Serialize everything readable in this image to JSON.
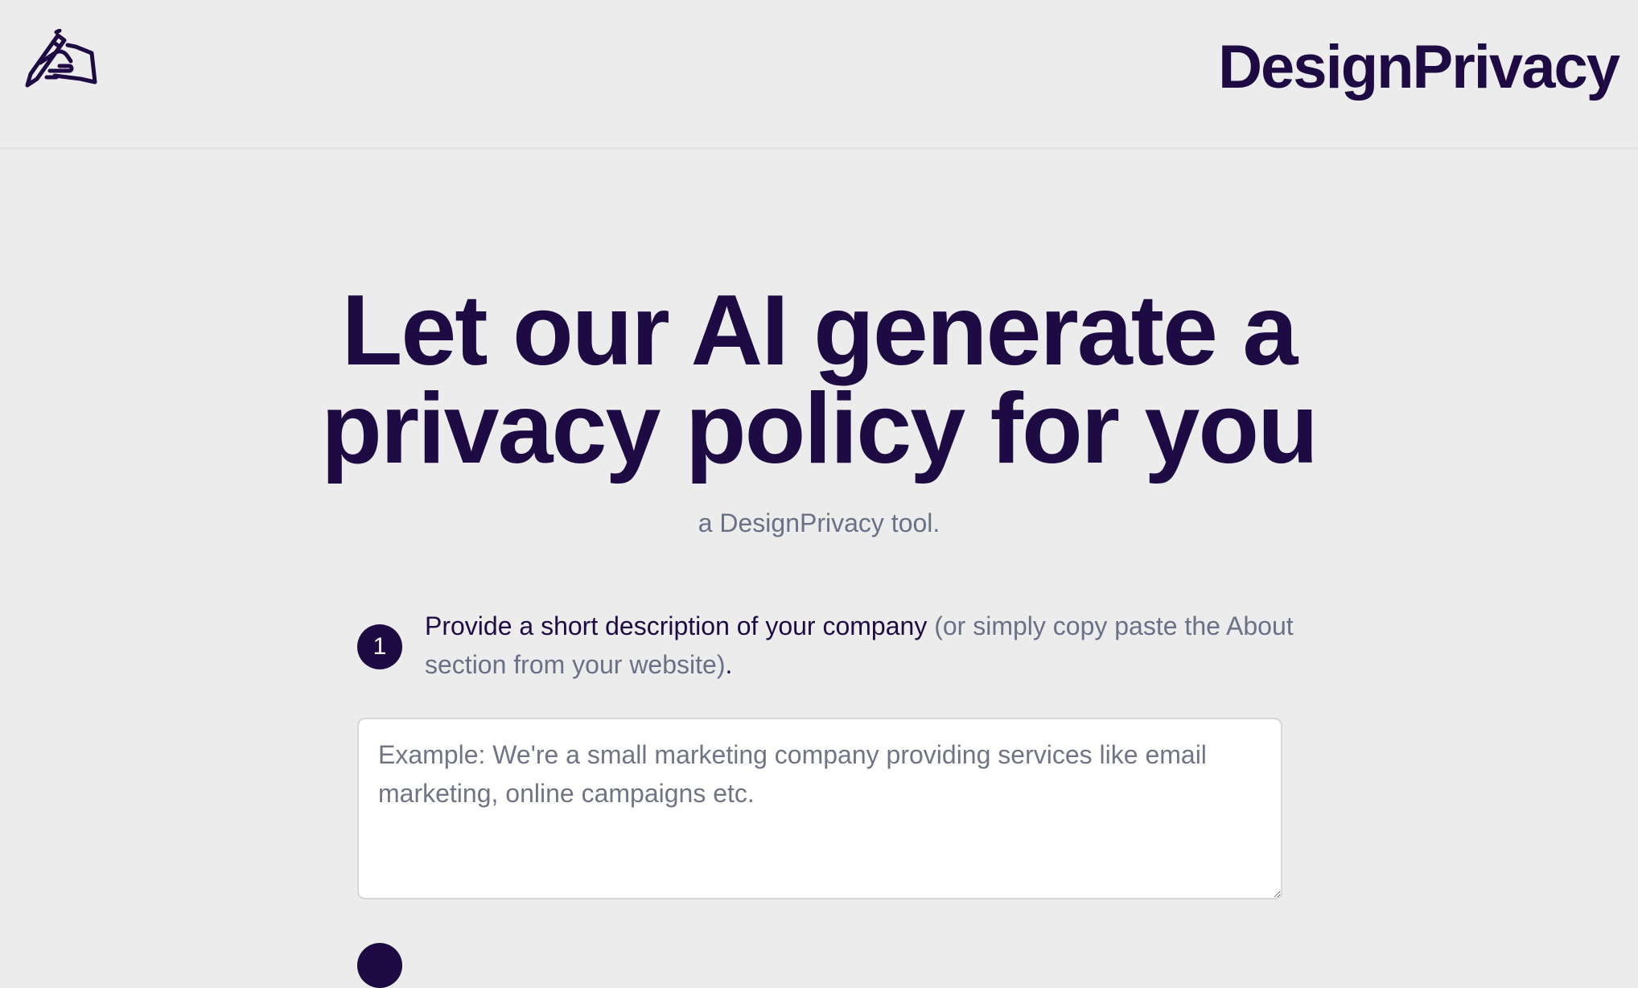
{
  "header": {
    "logo_icon": "hand-writing-icon",
    "brand": "DesignPrivacy"
  },
  "hero": {
    "title_line1": "Let our AI generate a",
    "title_line2": "privacy policy for you",
    "subtitle": "a DesignPrivacy tool."
  },
  "steps": [
    {
      "number": "1",
      "label_strong": "Provide a short description of your company",
      "label_muted": " (or simply copy paste the About section from your website)",
      "label_end": "."
    }
  ],
  "description_input": {
    "placeholder": "Example: We're a small marketing company providing services like email marketing, online campaigns etc.",
    "value": ""
  },
  "colors": {
    "background": "#ececec",
    "brand": "#1f0b43",
    "muted_text": "#6a7186"
  }
}
